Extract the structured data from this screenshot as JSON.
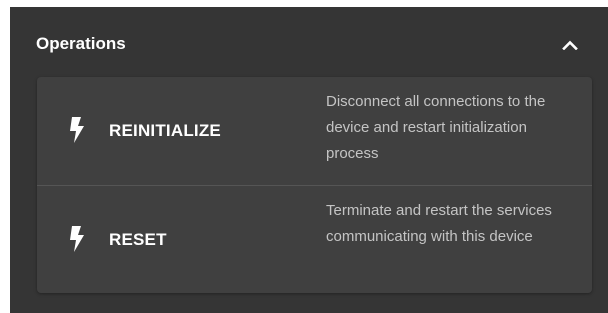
{
  "section": {
    "title": "Operations",
    "collapse_icon": "chevron-up-icon"
  },
  "operations": [
    {
      "label": "REINITIALIZE",
      "icon": "lightning-bolt-icon",
      "description": "Disconnect all connections to the device and restart initialization process"
    },
    {
      "label": "RESET",
      "icon": "lightning-bolt-icon",
      "description": "Terminate and restart the services communicating with this device"
    }
  ],
  "colors": {
    "panel_background": "#353535",
    "card_background": "#404040",
    "label_text": "#ffffff",
    "description_text": "#c4c4c4"
  }
}
